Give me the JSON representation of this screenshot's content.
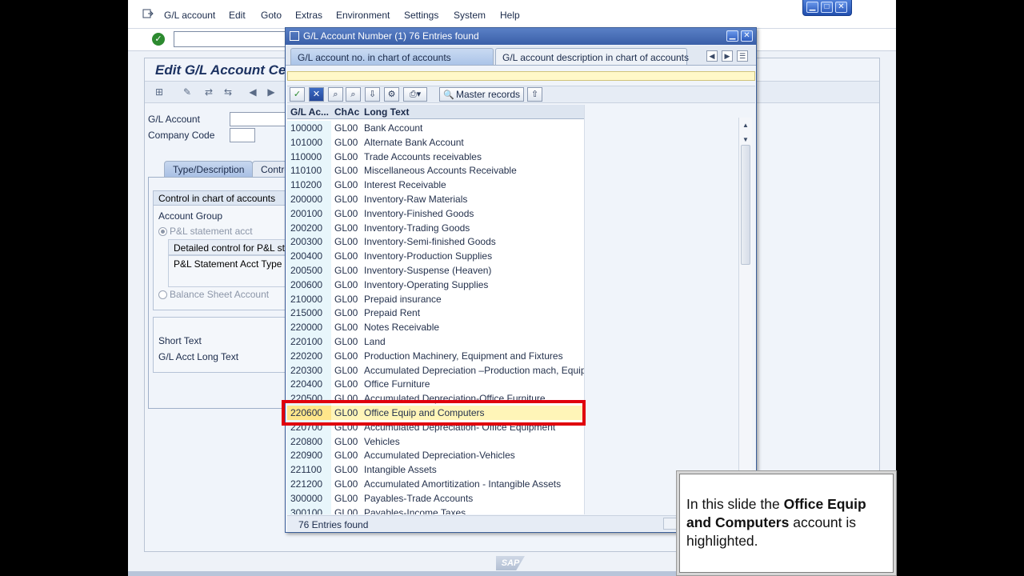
{
  "menubar": {
    "items": [
      "G/L account",
      "Edit",
      "Goto",
      "Extras",
      "Environment",
      "Settings",
      "System",
      "Help"
    ]
  },
  "window_controls": [
    "minimize",
    "maximize",
    "close"
  ],
  "main": {
    "title": "Edit G/L Account Ce",
    "fields": {
      "gl_account_label": "G/L Account",
      "company_code_label": "Company Code"
    },
    "tabs": [
      "Type/Description",
      "Contro"
    ],
    "control_group": {
      "title": "Control in chart of accounts",
      "account_group_label": "Account Group",
      "pl_radio": "P&L statement acct",
      "detail_row": "Detailed control for P&L sta",
      "pl_type_row": "P&L Statement Acct Type",
      "bs_radio": "Balance Sheet Account"
    },
    "desc_group": {
      "short_text": "Short Text",
      "long_text": "G/L Acct Long Text"
    },
    "logo": "SAP"
  },
  "popup": {
    "title": "G/L Account Number (1)   76 Entries found",
    "tabs": [
      "G/L account no. in chart of accounts",
      "G/L account description in chart of accounts"
    ],
    "toolbar": {
      "master_records": "Master records"
    },
    "columns": [
      "G/L Ac...",
      "ChAc",
      "Long Text"
    ],
    "rows": [
      {
        "acct": "100000",
        "chac": "GL00",
        "text": "Bank Account"
      },
      {
        "acct": "101000",
        "chac": "GL00",
        "text": "Alternate Bank Account"
      },
      {
        "acct": "110000",
        "chac": "GL00",
        "text": "Trade Accounts receivables"
      },
      {
        "acct": "110100",
        "chac": "GL00",
        "text": "Miscellaneous Accounts Receivable"
      },
      {
        "acct": "110200",
        "chac": "GL00",
        "text": "Interest Receivable"
      },
      {
        "acct": "200000",
        "chac": "GL00",
        "text": "Inventory-Raw Materials"
      },
      {
        "acct": "200100",
        "chac": "GL00",
        "text": "Inventory-Finished Goods"
      },
      {
        "acct": "200200",
        "chac": "GL00",
        "text": "Inventory-Trading Goods"
      },
      {
        "acct": "200300",
        "chac": "GL00",
        "text": "Inventory-Semi-finished Goods"
      },
      {
        "acct": "200400",
        "chac": "GL00",
        "text": "Inventory-Production Supplies"
      },
      {
        "acct": "200500",
        "chac": "GL00",
        "text": "Inventory-Suspense (Heaven)"
      },
      {
        "acct": "200600",
        "chac": "GL00",
        "text": "Inventory-Operating Supplies"
      },
      {
        "acct": "210000",
        "chac": "GL00",
        "text": "Prepaid insurance"
      },
      {
        "acct": "215000",
        "chac": "GL00",
        "text": "Prepaid Rent"
      },
      {
        "acct": "220000",
        "chac": "GL00",
        "text": "Notes Receivable"
      },
      {
        "acct": "220100",
        "chac": "GL00",
        "text": "Land"
      },
      {
        "acct": "220200",
        "chac": "GL00",
        "text": "Production Machinery, Equipment and Fixtures"
      },
      {
        "acct": "220300",
        "chac": "GL00",
        "text": "Accumulated Depreciation –Production mach, Equip."
      },
      {
        "acct": "220400",
        "chac": "GL00",
        "text": "Office Furniture"
      },
      {
        "acct": "220500",
        "chac": "GL00",
        "text": "Accumulated Depreciation-Office Furniture"
      },
      {
        "acct": "220600",
        "chac": "GL00",
        "text": "Office Equip and Computers",
        "selected": true
      },
      {
        "acct": "220700",
        "chac": "GL00",
        "text": "Accumulated Depreciation- Office Equipment"
      },
      {
        "acct": "220800",
        "chac": "GL00",
        "text": "Vehicles"
      },
      {
        "acct": "220900",
        "chac": "GL00",
        "text": "Accumulated Depreciation-Vehicles"
      },
      {
        "acct": "221100",
        "chac": "GL00",
        "text": "Intangible Assets"
      },
      {
        "acct": "221200",
        "chac": "GL00",
        "text": "Accumulated Amortitization - Intangible Assets"
      },
      {
        "acct": "300000",
        "chac": "GL00",
        "text": "Payables-Trade Accounts"
      },
      {
        "acct": "300100",
        "chac": "GL00",
        "text": "Payables-Income Taxes"
      }
    ],
    "status": "76 Entries found"
  },
  "callout": {
    "before": "In this slide the ",
    "bold": "Office Equip and Computers",
    "after": " account is highlighted."
  },
  "colors": {
    "highlight": "#e0000d",
    "selected_row": "#fff5b8"
  }
}
